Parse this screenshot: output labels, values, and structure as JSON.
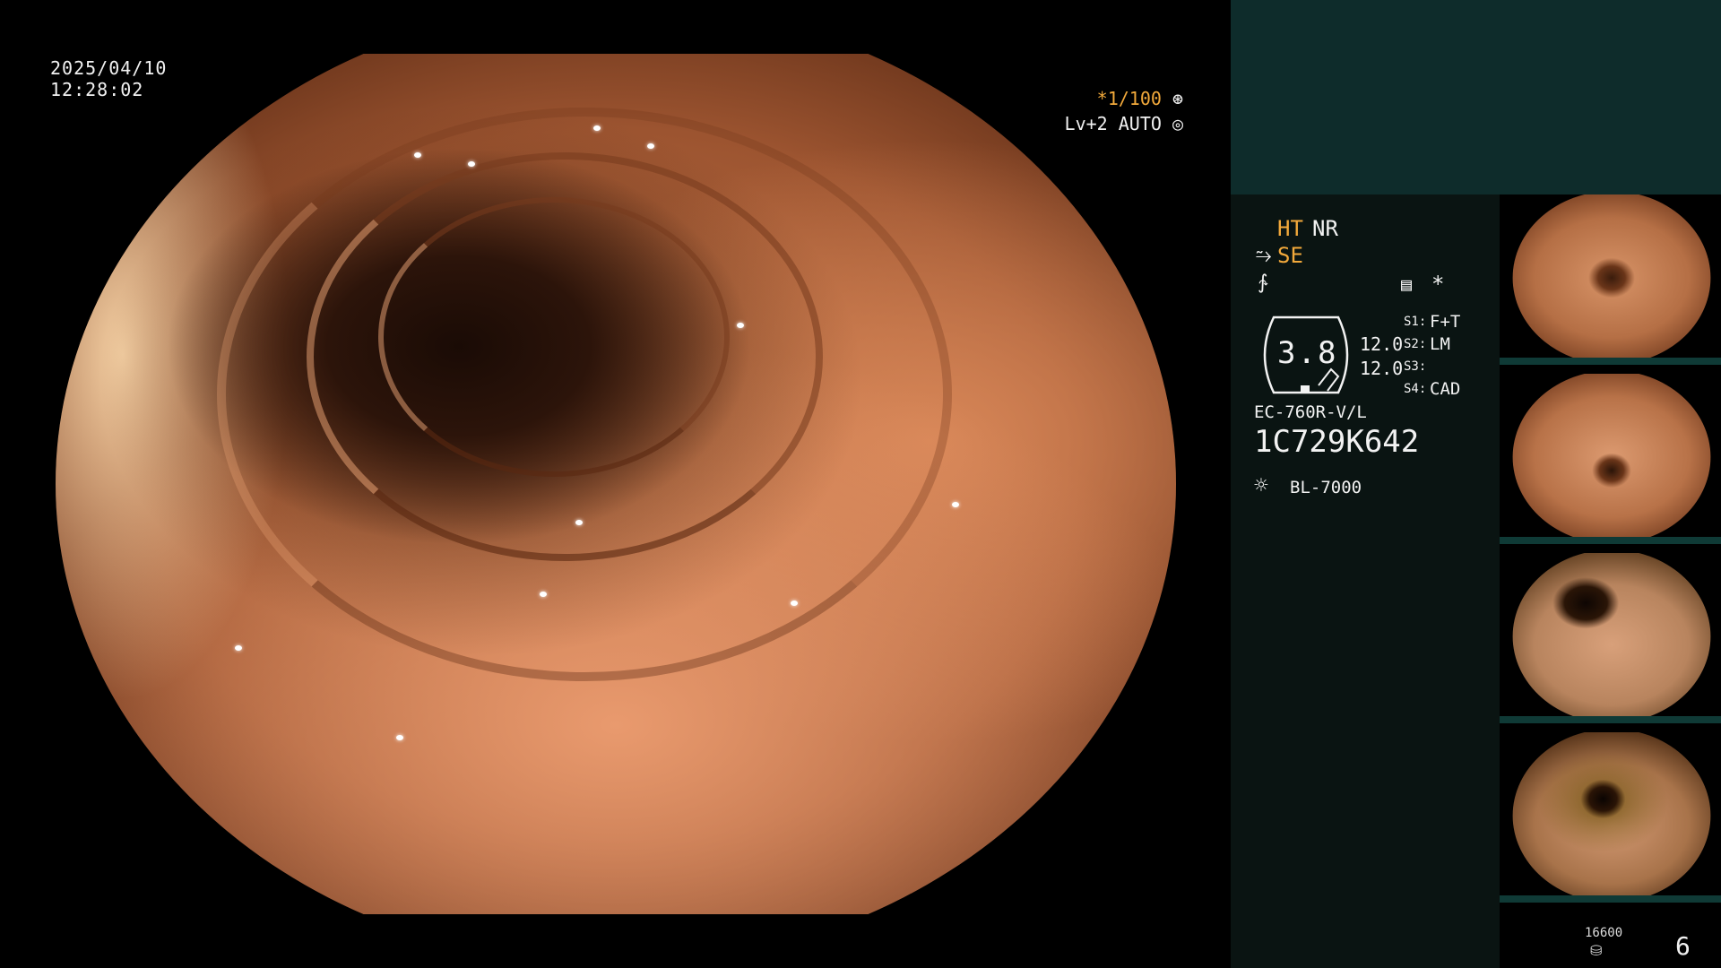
{
  "overlay": {
    "date": "2025/04/10",
    "time": "12:28:02",
    "shutter": "*1/100",
    "iris": "Lv+2 AUTO"
  },
  "panel": {
    "ht": "HT",
    "nr": "NR",
    "se": "SE",
    "zoom_value": "3.8",
    "value_top": "12.0",
    "value_bottom": "12.0",
    "s1_label": "S1:",
    "s1_value": "F+T",
    "s2_label": "S2:",
    "s2_value": "LM",
    "s3_label": "S3:",
    "s3_value": "",
    "s4_label": "S4:",
    "s4_value": "CAD",
    "scope_model": "EC-760R-V/L",
    "serial": "1C729K642",
    "light_source": "BL-7000",
    "storage_count": "16600",
    "image_count": "6"
  },
  "thumbnails": [
    {
      "name": "thumb-1"
    },
    {
      "name": "thumb-2"
    },
    {
      "name": "thumb-3"
    },
    {
      "name": "thumb-4"
    }
  ],
  "icons": [
    "aperture-icon",
    "iris-icon",
    "enhance-icon",
    "freeze-icon",
    "memo-icon",
    "star-icon",
    "light-source-icon",
    "storage-icon"
  ],
  "colors": {
    "panel_bg": "#0a1412",
    "panel_top_bg": "#0e2c2b",
    "accent": "#f2a93b"
  }
}
